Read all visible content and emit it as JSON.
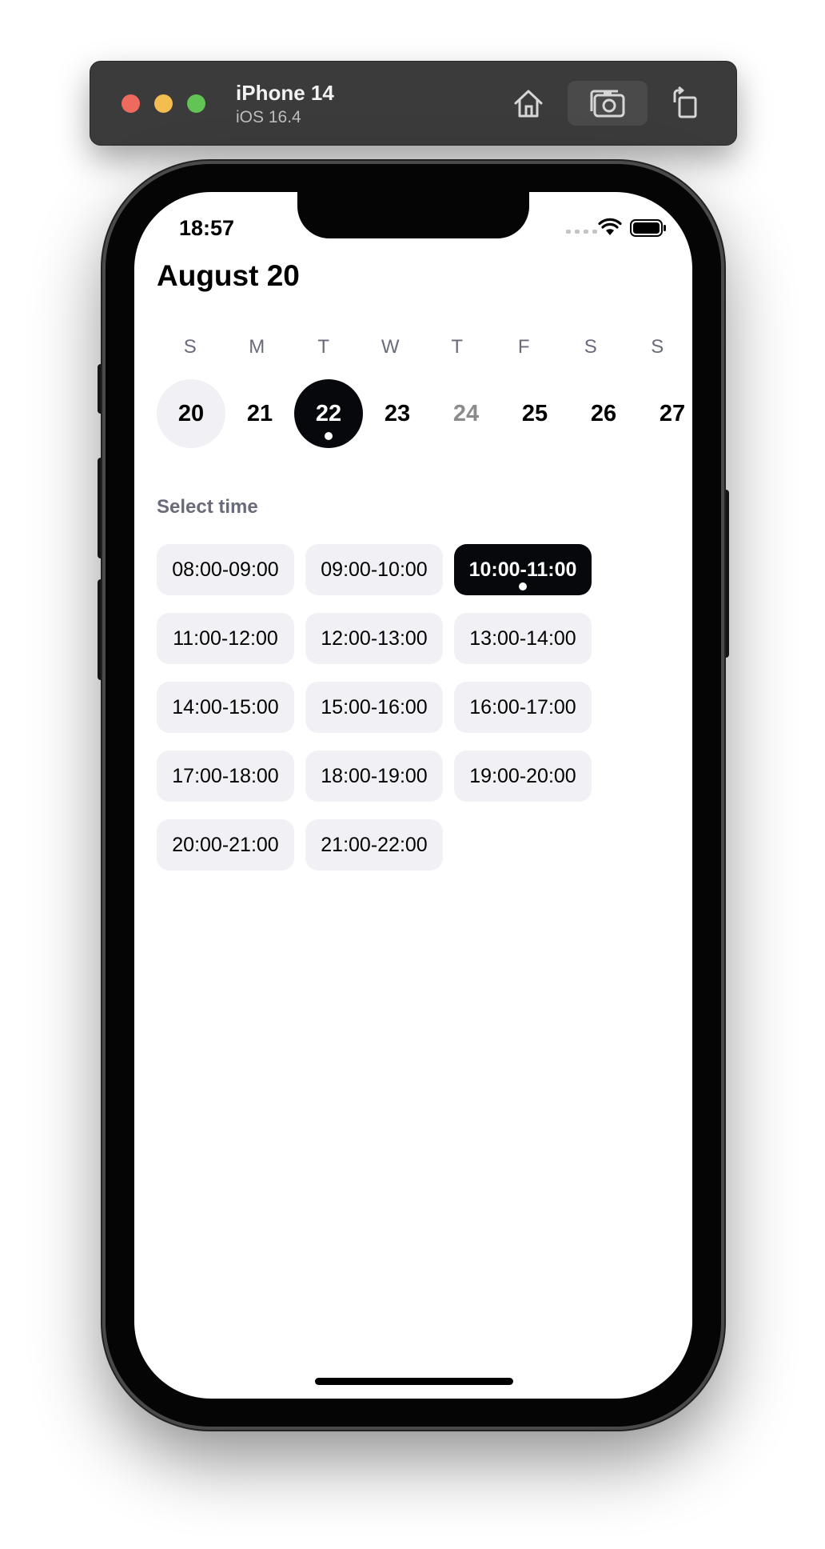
{
  "simulator": {
    "device_name": "iPhone 14",
    "os_version": "iOS 16.4"
  },
  "status_bar": {
    "time": "18:57"
  },
  "header": {
    "title": "August 20"
  },
  "week": {
    "weekdays": [
      "S",
      "M",
      "T",
      "W",
      "T",
      "F",
      "S",
      "S"
    ],
    "dates": [
      "20",
      "21",
      "22",
      "23",
      "24",
      "25",
      "26",
      "27"
    ]
  },
  "time_section": {
    "label": "Select time",
    "slots": [
      "08:00-09:00",
      "09:00-10:00",
      "10:00-11:00",
      "11:00-12:00",
      "12:00-13:00",
      "13:00-14:00",
      "14:00-15:00",
      "15:00-16:00",
      "16:00-17:00",
      "17:00-18:00",
      "18:00-19:00",
      "19:00-20:00",
      "20:00-21:00",
      "21:00-22:00"
    ]
  },
  "colors": {
    "selected": "#07080c",
    "chip_bg": "#f0f0f5",
    "secondary_text": "#6a6b7a"
  }
}
